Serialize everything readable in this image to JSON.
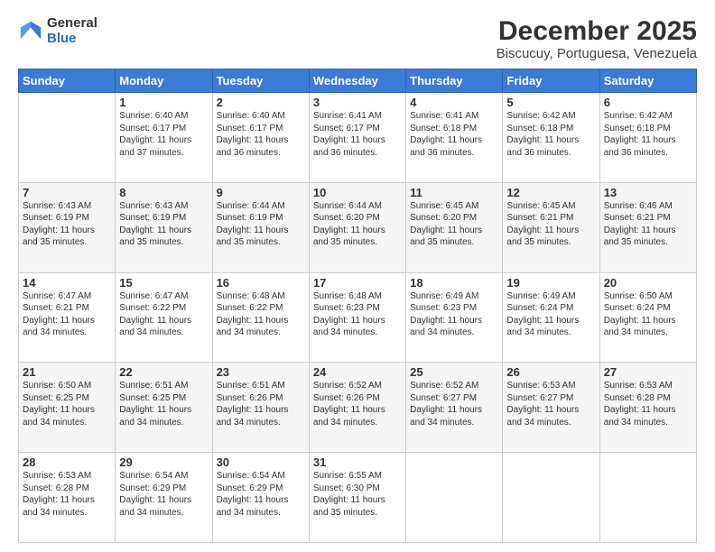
{
  "logo": {
    "general": "General",
    "blue": "Blue"
  },
  "title": "December 2025",
  "subtitle": "Biscucuy, Portuguesa, Venezuela",
  "days": [
    "Sunday",
    "Monday",
    "Tuesday",
    "Wednesday",
    "Thursday",
    "Friday",
    "Saturday"
  ],
  "weeks": [
    [
      {
        "num": "",
        "sunrise": "",
        "sunset": "",
        "daylight": ""
      },
      {
        "num": "1",
        "sunrise": "Sunrise: 6:40 AM",
        "sunset": "Sunset: 6:17 PM",
        "daylight": "Daylight: 11 hours and 37 minutes."
      },
      {
        "num": "2",
        "sunrise": "Sunrise: 6:40 AM",
        "sunset": "Sunset: 6:17 PM",
        "daylight": "Daylight: 11 hours and 36 minutes."
      },
      {
        "num": "3",
        "sunrise": "Sunrise: 6:41 AM",
        "sunset": "Sunset: 6:17 PM",
        "daylight": "Daylight: 11 hours and 36 minutes."
      },
      {
        "num": "4",
        "sunrise": "Sunrise: 6:41 AM",
        "sunset": "Sunset: 6:18 PM",
        "daylight": "Daylight: 11 hours and 36 minutes."
      },
      {
        "num": "5",
        "sunrise": "Sunrise: 6:42 AM",
        "sunset": "Sunset: 6:18 PM",
        "daylight": "Daylight: 11 hours and 36 minutes."
      },
      {
        "num": "6",
        "sunrise": "Sunrise: 6:42 AM",
        "sunset": "Sunset: 6:18 PM",
        "daylight": "Daylight: 11 hours and 36 minutes."
      }
    ],
    [
      {
        "num": "7",
        "sunrise": "Sunrise: 6:43 AM",
        "sunset": "Sunset: 6:19 PM",
        "daylight": "Daylight: 11 hours and 35 minutes."
      },
      {
        "num": "8",
        "sunrise": "Sunrise: 6:43 AM",
        "sunset": "Sunset: 6:19 PM",
        "daylight": "Daylight: 11 hours and 35 minutes."
      },
      {
        "num": "9",
        "sunrise": "Sunrise: 6:44 AM",
        "sunset": "Sunset: 6:19 PM",
        "daylight": "Daylight: 11 hours and 35 minutes."
      },
      {
        "num": "10",
        "sunrise": "Sunrise: 6:44 AM",
        "sunset": "Sunset: 6:20 PM",
        "daylight": "Daylight: 11 hours and 35 minutes."
      },
      {
        "num": "11",
        "sunrise": "Sunrise: 6:45 AM",
        "sunset": "Sunset: 6:20 PM",
        "daylight": "Daylight: 11 hours and 35 minutes."
      },
      {
        "num": "12",
        "sunrise": "Sunrise: 6:45 AM",
        "sunset": "Sunset: 6:21 PM",
        "daylight": "Daylight: 11 hours and 35 minutes."
      },
      {
        "num": "13",
        "sunrise": "Sunrise: 6:46 AM",
        "sunset": "Sunset: 6:21 PM",
        "daylight": "Daylight: 11 hours and 35 minutes."
      }
    ],
    [
      {
        "num": "14",
        "sunrise": "Sunrise: 6:47 AM",
        "sunset": "Sunset: 6:21 PM",
        "daylight": "Daylight: 11 hours and 34 minutes."
      },
      {
        "num": "15",
        "sunrise": "Sunrise: 6:47 AM",
        "sunset": "Sunset: 6:22 PM",
        "daylight": "Daylight: 11 hours and 34 minutes."
      },
      {
        "num": "16",
        "sunrise": "Sunrise: 6:48 AM",
        "sunset": "Sunset: 6:22 PM",
        "daylight": "Daylight: 11 hours and 34 minutes."
      },
      {
        "num": "17",
        "sunrise": "Sunrise: 6:48 AM",
        "sunset": "Sunset: 6:23 PM",
        "daylight": "Daylight: 11 hours and 34 minutes."
      },
      {
        "num": "18",
        "sunrise": "Sunrise: 6:49 AM",
        "sunset": "Sunset: 6:23 PM",
        "daylight": "Daylight: 11 hours and 34 minutes."
      },
      {
        "num": "19",
        "sunrise": "Sunrise: 6:49 AM",
        "sunset": "Sunset: 6:24 PM",
        "daylight": "Daylight: 11 hours and 34 minutes."
      },
      {
        "num": "20",
        "sunrise": "Sunrise: 6:50 AM",
        "sunset": "Sunset: 6:24 PM",
        "daylight": "Daylight: 11 hours and 34 minutes."
      }
    ],
    [
      {
        "num": "21",
        "sunrise": "Sunrise: 6:50 AM",
        "sunset": "Sunset: 6:25 PM",
        "daylight": "Daylight: 11 hours and 34 minutes."
      },
      {
        "num": "22",
        "sunrise": "Sunrise: 6:51 AM",
        "sunset": "Sunset: 6:25 PM",
        "daylight": "Daylight: 11 hours and 34 minutes."
      },
      {
        "num": "23",
        "sunrise": "Sunrise: 6:51 AM",
        "sunset": "Sunset: 6:26 PM",
        "daylight": "Daylight: 11 hours and 34 minutes."
      },
      {
        "num": "24",
        "sunrise": "Sunrise: 6:52 AM",
        "sunset": "Sunset: 6:26 PM",
        "daylight": "Daylight: 11 hours and 34 minutes."
      },
      {
        "num": "25",
        "sunrise": "Sunrise: 6:52 AM",
        "sunset": "Sunset: 6:27 PM",
        "daylight": "Daylight: 11 hours and 34 minutes."
      },
      {
        "num": "26",
        "sunrise": "Sunrise: 6:53 AM",
        "sunset": "Sunset: 6:27 PM",
        "daylight": "Daylight: 11 hours and 34 minutes."
      },
      {
        "num": "27",
        "sunrise": "Sunrise: 6:53 AM",
        "sunset": "Sunset: 6:28 PM",
        "daylight": "Daylight: 11 hours and 34 minutes."
      }
    ],
    [
      {
        "num": "28",
        "sunrise": "Sunrise: 6:53 AM",
        "sunset": "Sunset: 6:28 PM",
        "daylight": "Daylight: 11 hours and 34 minutes."
      },
      {
        "num": "29",
        "sunrise": "Sunrise: 6:54 AM",
        "sunset": "Sunset: 6:29 PM",
        "daylight": "Daylight: 11 hours and 34 minutes."
      },
      {
        "num": "30",
        "sunrise": "Sunrise: 6:54 AM",
        "sunset": "Sunset: 6:29 PM",
        "daylight": "Daylight: 11 hours and 34 minutes."
      },
      {
        "num": "31",
        "sunrise": "Sunrise: 6:55 AM",
        "sunset": "Sunset: 6:30 PM",
        "daylight": "Daylight: 11 hours and 35 minutes."
      },
      {
        "num": "",
        "sunrise": "",
        "sunset": "",
        "daylight": ""
      },
      {
        "num": "",
        "sunrise": "",
        "sunset": "",
        "daylight": ""
      },
      {
        "num": "",
        "sunrise": "",
        "sunset": "",
        "daylight": ""
      }
    ]
  ]
}
